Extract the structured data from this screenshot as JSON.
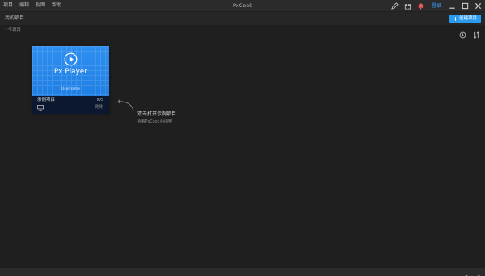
{
  "window": {
    "title": "PxCook"
  },
  "menu": [
    "项目",
    "编辑",
    "视图",
    "帮助"
  ],
  "titlebar": {
    "login_label": "登录"
  },
  "header": {
    "title": "我的项目",
    "new_project_label": "创建项目"
  },
  "subheader": {
    "count_label": "1个项目"
  },
  "project_card": {
    "thumbnail_title": "Px Player",
    "owner": "Username",
    "name": "示例项目",
    "platform": "iOS",
    "updated": "刚刚"
  },
  "hint": {
    "title": "双击打开示例项目",
    "subtitle": "查看PxCook多好用!"
  },
  "icons": {
    "pen": "pen-icon",
    "gift": "gift-icon",
    "bell": "bell-icon",
    "minimize": "minimize-icon",
    "maximize": "maximize-icon",
    "close": "close-icon",
    "plus": "plus-icon",
    "clock": "clock-icon",
    "sort": "sort-icon",
    "play": "play-icon",
    "monitor": "monitor-icon",
    "home": "home-icon",
    "share": "share-icon"
  },
  "colors": {
    "accent": "#2b9bf0",
    "background": "#1f1f1f",
    "titlebar": "#2b2b2b",
    "card_thumb": "#2e8ef0"
  }
}
